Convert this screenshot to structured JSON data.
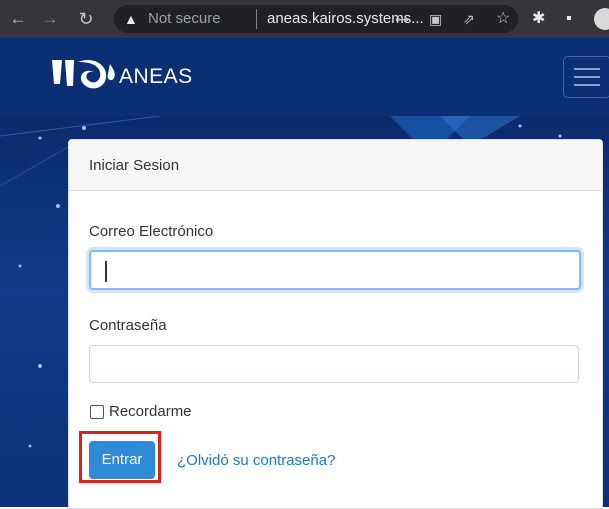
{
  "browser": {
    "back_icon": "arrow-left-icon",
    "forward_icon": "arrow-right-icon",
    "reload_icon": "reload-icon",
    "security_icon": "warning-triangle-icon",
    "security_text": "Not secure",
    "url": "aneas.kairos.systems...",
    "key_icon": "key-icon",
    "translate_icon": "translate-icon",
    "share_icon": "share-icon",
    "bookmark_icon": "star-icon",
    "extensions_icon": "puzzle-icon",
    "sidepanel_icon": "side-panel-icon",
    "profile_icon": "avatar-icon"
  },
  "site": {
    "brand": "ANEAS",
    "logo_icon": "aneas-logo-icon",
    "menu_icon": "hamburger-icon",
    "header_color": "#0b2f74"
  },
  "login": {
    "title": "Iniciar Sesion",
    "email_label": "Correo Electrónico",
    "email_value": "",
    "password_label": "Contraseña",
    "password_value": "",
    "remember_label": "Recordarme",
    "remember_checked": false,
    "submit_label": "Entrar",
    "forgot_link": "¿Olvidó su contraseña?",
    "accent": "#2f8ad8",
    "highlight_color": "#e0211b"
  }
}
